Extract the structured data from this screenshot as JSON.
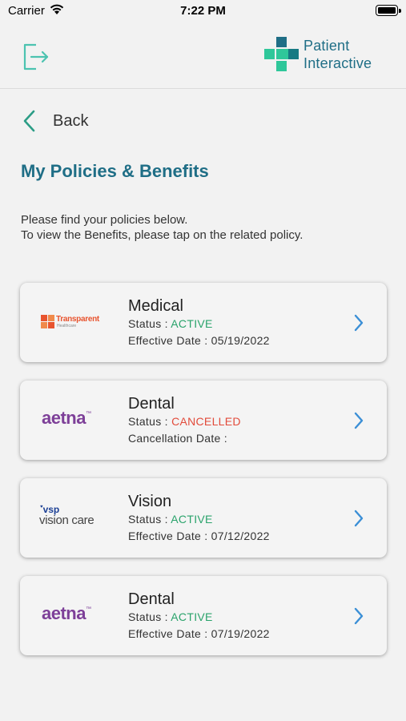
{
  "status_bar": {
    "carrier": "Carrier",
    "time": "7:22 PM"
  },
  "header": {
    "brand_line1": "Patient",
    "brand_line2": "Interactive",
    "brand_colors": {
      "teal": "#1f6e86",
      "green": "#2fc79a",
      "dark_teal": "#177a83"
    }
  },
  "nav": {
    "back_label": "Back"
  },
  "page": {
    "title": "My Policies & Benefits",
    "intro_line1": "Please find your policies below.",
    "intro_line2": "To view the Benefits, please tap on the related policy."
  },
  "policies": [
    {
      "type": "Medical",
      "status_label": "Status : ",
      "status": "ACTIVE",
      "date_label": "Effective Date : ",
      "date": "05/19/2022",
      "logo": "transparent-healthcare-logo",
      "logo_text": "Transparent",
      "logo_subtext": "Healthcare"
    },
    {
      "type": "Dental",
      "status_label": "Status : ",
      "status": "CANCELLED",
      "date_label": "Cancellation Date : ",
      "date": "",
      "logo": "aetna-logo",
      "logo_text": "aetna"
    },
    {
      "type": "Vision",
      "status_label": "Status : ",
      "status": "ACTIVE",
      "date_label": "Effective Date : ",
      "date": "07/12/2022",
      "logo": "vsp-vision-care-logo",
      "logo_text": "vsp",
      "logo_subtext": "vision care"
    },
    {
      "type": "Dental",
      "status_label": "Status : ",
      "status": "ACTIVE",
      "date_label": "Effective Date : ",
      "date": "07/19/2022",
      "logo": "aetna-logo",
      "logo_text": "aetna"
    }
  ],
  "colors": {
    "active": "#2aa36b",
    "cancelled": "#e24b3b",
    "chevron": "#3b8fd6",
    "title": "#1f6e86"
  }
}
